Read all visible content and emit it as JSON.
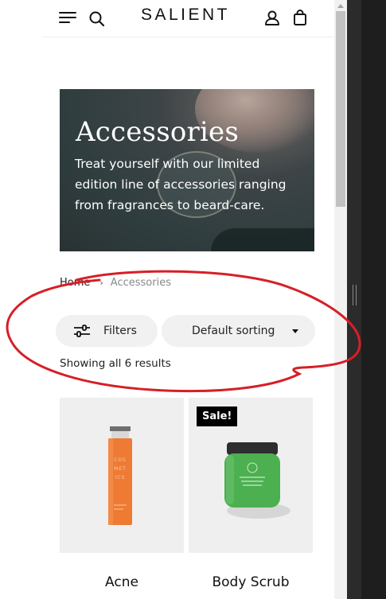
{
  "header": {
    "logo": "SALIENT",
    "icons": [
      "menu-icon",
      "search-icon",
      "user-icon",
      "shopping-bag-icon"
    ]
  },
  "hero": {
    "title": "Accessories",
    "description": "Treat yourself with our limited edition line of accessories ranging from fragrances to beard-care."
  },
  "breadcrumb": {
    "home": "Home",
    "separator": "›",
    "current": "Accessories"
  },
  "toolbar": {
    "filters_label": "Filters",
    "sort_selected": "Default sorting",
    "result_count": "Showing all 6 results"
  },
  "products": [
    {
      "title": "Acne",
      "badge": "",
      "bottle_label": "COS MET ICS"
    },
    {
      "title": "Body Scrub",
      "badge": "Sale!"
    }
  ],
  "colors": {
    "annotation_stroke": "#d61f26",
    "button_bg": "#f1f1f1",
    "product_bg": "#efefef",
    "bottle_orange": "#ef7a33",
    "jar_green": "#4caf50"
  }
}
